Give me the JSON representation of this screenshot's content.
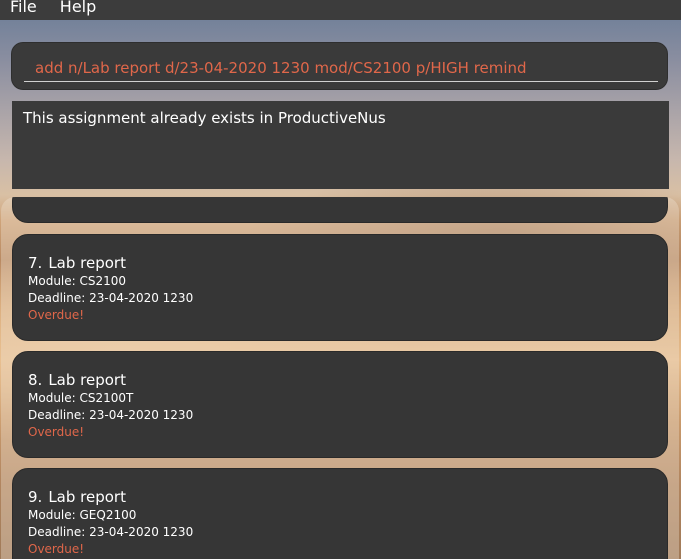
{
  "menu": {
    "file": "File",
    "help": "Help"
  },
  "command_box": {
    "value": "add n/Lab report d/23-04-2020 1230 mod/CS2100 p/HIGH remind"
  },
  "result_box": {
    "text": "This assignment already exists in ProductiveNus"
  },
  "assignments": [
    {
      "index": "7.",
      "name": "Lab report",
      "module": "Module: CS2100",
      "deadline": "Deadline: 23-04-2020 1230",
      "status": "Overdue!"
    },
    {
      "index": "8.",
      "name": "Lab report",
      "module": "Module: CS2100T",
      "deadline": "Deadline: 23-04-2020 1230",
      "status": "Overdue!"
    },
    {
      "index": "9.",
      "name": "Lab report",
      "module": "Module: GEQ2100",
      "deadline": "Deadline: 23-04-2020 1230",
      "status": "Overdue!"
    }
  ],
  "colors": {
    "accent": "#e0674a",
    "panel": "#3a3a3a",
    "card": "#363636"
  }
}
